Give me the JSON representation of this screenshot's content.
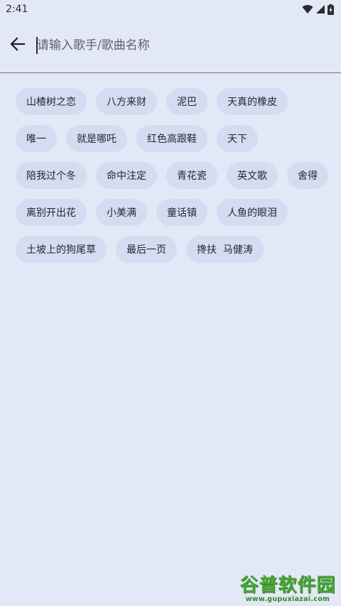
{
  "status_bar": {
    "time": "2:41",
    "icons": [
      "wifi-icon",
      "cellular-signal-icon",
      "battery-charging-icon"
    ]
  },
  "search": {
    "back_icon": "arrow-left-icon",
    "placeholder": "请输入歌手/歌曲名称",
    "value": ""
  },
  "suggestions": [
    "山楂树之恋",
    "八方来财",
    "泥巴",
    "天真的橡皮",
    "唯一",
    "就是哪吒",
    "红色高跟鞋",
    "天下",
    "陪我过个冬",
    "命中注定",
    "青花瓷",
    "英文歌",
    "舍得",
    "离别开出花",
    "小美满",
    "童话镇",
    "人鱼的眼泪",
    "土坡上的狗尾草",
    "最后一页",
    "搀扶  马健涛"
  ],
  "watermark": {
    "title": "谷普软件园",
    "url": "www.gupuxiazai.com"
  },
  "colors": {
    "background": "#e3e8f6",
    "chip_background": "#d5dcf2",
    "watermark_green": "#4aa63a"
  }
}
